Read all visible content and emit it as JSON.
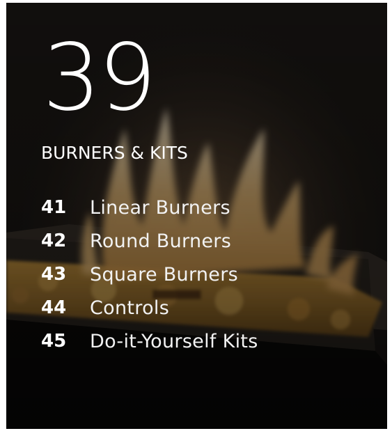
{
  "page_number": "39",
  "section_title": "BURNERS & KITS",
  "contents": [
    {
      "page": "41",
      "label": "Linear Burners"
    },
    {
      "page": "42",
      "label": "Round Burners"
    },
    {
      "page": "43",
      "label": "Square Burners"
    },
    {
      "page": "44",
      "label": "Controls"
    },
    {
      "page": "45",
      "label": "Do-it-Yourself Kits"
    }
  ],
  "colors": {
    "text": "#ffffff",
    "background": "#151311",
    "flame": "#f2c27a",
    "glass": "#b8862e"
  }
}
